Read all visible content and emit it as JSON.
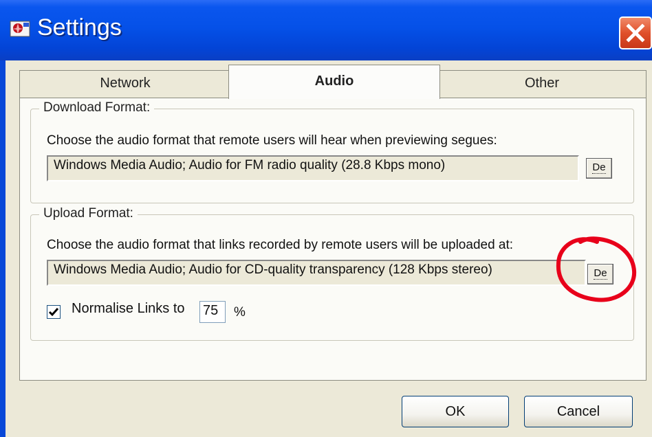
{
  "window": {
    "title": "Settings",
    "app_icon": "settings-app-icon",
    "close_icon": "close-icon"
  },
  "tabs": [
    {
      "label": "Network",
      "selected": false
    },
    {
      "label": "Audio",
      "selected": true
    },
    {
      "label": "Other",
      "selected": false
    }
  ],
  "download": {
    "legend": "Download Format:",
    "description": "Choose the audio format that remote users will hear when previewing segues:",
    "format_value": "Windows Media Audio; Audio for FM radio quality (28.8 Kbps mono)",
    "button_label": "De"
  },
  "upload": {
    "legend": "Upload Format:",
    "description": "Choose the audio format that links recorded by remote users will be uploaded at:",
    "format_value": "Windows Media Audio; Audio for CD-quality transparency (128 Kbps stereo)",
    "button_label": "De",
    "normalise_label": "Normalise Links to",
    "normalise_checked": true,
    "normalise_value": "75",
    "percent_sign": "%"
  },
  "buttons": {
    "ok_label": "OK",
    "cancel_label": "Cancel"
  },
  "colors": {
    "titlebar": "#0551e8",
    "close": "#e0502a",
    "annotation": "#e8001a"
  }
}
